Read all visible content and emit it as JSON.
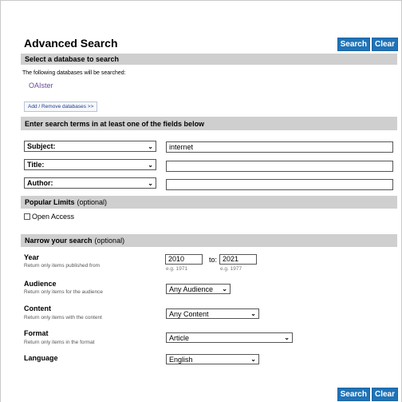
{
  "page": {
    "title": "Advanced Search",
    "search_button": "Search",
    "clear_button": "Clear"
  },
  "database": {
    "header": "Select a database to search",
    "note": "The following databases will be searched:",
    "selected": "OAIster",
    "add_remove": "Add / Remove databases >>"
  },
  "terms": {
    "header": "Enter search terms in at least one of the fields below",
    "fields": [
      {
        "label": "Subject:",
        "value": "internet"
      },
      {
        "label": "Title:",
        "value": ""
      },
      {
        "label": "Author:",
        "value": ""
      }
    ]
  },
  "limits": {
    "header": "Popular Limits",
    "optional": "(optional)",
    "open_access": "Open Access"
  },
  "narrow": {
    "header": "Narrow your search",
    "optional": "(optional)",
    "year": {
      "label": "Year",
      "sub": "Return only items published from",
      "from": "2010",
      "to_label": "to:",
      "to": "2021",
      "eg_from": "e.g. 1971",
      "eg_to": "e.g. 1977"
    },
    "audience": {
      "label": "Audience",
      "sub": "Return only items for the audience",
      "value": "Any Audience"
    },
    "content": {
      "label": "Content",
      "sub": "Return only items with the content",
      "value": "Any Content"
    },
    "format": {
      "label": "Format",
      "sub": "Return only items in the format",
      "value": "Article"
    },
    "language": {
      "label": "Language",
      "value": "English"
    }
  },
  "icons": {
    "chevron": "chevron-down-icon",
    "checkbox": "checkbox-icon"
  },
  "colors": {
    "accent": "#1f73b7",
    "section_bar": "#cfcfcf",
    "link": "#6a4a9a"
  }
}
